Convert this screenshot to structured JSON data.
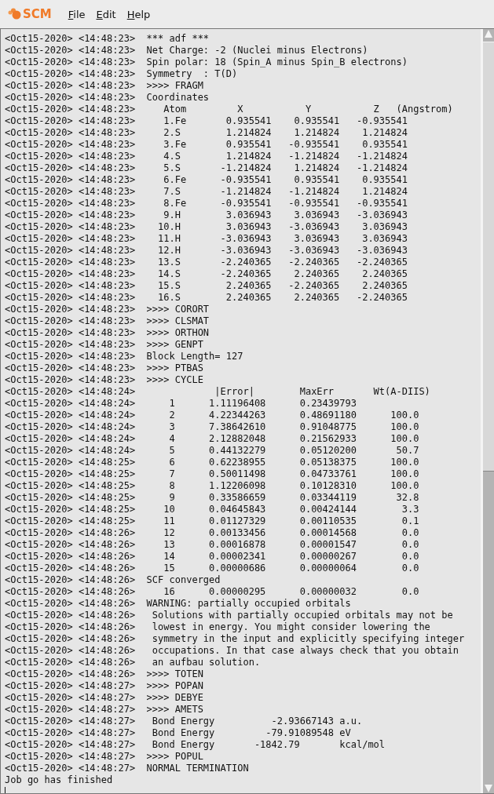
{
  "app": {
    "logo_text": "SCM"
  },
  "menu": [
    {
      "label": "File"
    },
    {
      "label": "Edit"
    },
    {
      "label": "Help"
    }
  ],
  "log": {
    "lines": [
      "<Oct15-2020> <14:48:23>  *** adf ***",
      "<Oct15-2020> <14:48:23>  Net Charge: -2 (Nuclei minus Electrons)",
      "<Oct15-2020> <14:48:23>  Spin polar: 18 (Spin_A minus Spin_B electrons)",
      "<Oct15-2020> <14:48:23>  Symmetry  : T(D)",
      "<Oct15-2020> <14:48:23>  >>>> FRAGM",
      "<Oct15-2020> <14:48:23>  Coordinates",
      "<Oct15-2020> <14:48:23>     Atom         X           Y           Z   (Angstrom)",
      "<Oct15-2020> <14:48:23>     1.Fe       0.935541    0.935541   -0.935541",
      "<Oct15-2020> <14:48:23>     2.S        1.214824    1.214824    1.214824",
      "<Oct15-2020> <14:48:23>     3.Fe       0.935541   -0.935541    0.935541",
      "<Oct15-2020> <14:48:23>     4.S        1.214824   -1.214824   -1.214824",
      "<Oct15-2020> <14:48:23>     5.S       -1.214824    1.214824   -1.214824",
      "<Oct15-2020> <14:48:23>     6.Fe      -0.935541    0.935541    0.935541",
      "<Oct15-2020> <14:48:23>     7.S       -1.214824   -1.214824    1.214824",
      "<Oct15-2020> <14:48:23>     8.Fe      -0.935541   -0.935541   -0.935541",
      "<Oct15-2020> <14:48:23>     9.H        3.036943    3.036943   -3.036943",
      "<Oct15-2020> <14:48:23>    10.H        3.036943   -3.036943    3.036943",
      "<Oct15-2020> <14:48:23>    11.H       -3.036943    3.036943    3.036943",
      "<Oct15-2020> <14:48:23>    12.H       -3.036943   -3.036943   -3.036943",
      "<Oct15-2020> <14:48:23>    13.S       -2.240365   -2.240365   -2.240365",
      "<Oct15-2020> <14:48:23>    14.S       -2.240365    2.240365    2.240365",
      "<Oct15-2020> <14:48:23>    15.S        2.240365   -2.240365    2.240365",
      "<Oct15-2020> <14:48:23>    16.S        2.240365    2.240365   -2.240365",
      "<Oct15-2020> <14:48:23>  >>>> CORORT",
      "<Oct15-2020> <14:48:23>  >>>> CLSMAT",
      "<Oct15-2020> <14:48:23>  >>>> ORTHON",
      "<Oct15-2020> <14:48:23>  >>>> GENPT",
      "<Oct15-2020> <14:48:23>  Block Length= 127",
      "<Oct15-2020> <14:48:23>  >>>> PTBAS",
      "<Oct15-2020> <14:48:23>  >>>> CYCLE",
      "<Oct15-2020> <14:48:24>              |Error|        MaxErr       Wt(A-DIIS)",
      "<Oct15-2020> <14:48:24>      1      1.11196408      0.23439793",
      "<Oct15-2020> <14:48:24>      2      4.22344263      0.48691180      100.0",
      "<Oct15-2020> <14:48:24>      3      7.38642610      0.91048775      100.0",
      "<Oct15-2020> <14:48:24>      4      2.12882048      0.21562933      100.0",
      "<Oct15-2020> <14:48:24>      5      0.44132279      0.05120200       50.7",
      "<Oct15-2020> <14:48:25>      6      0.62238955      0.05138375      100.0",
      "<Oct15-2020> <14:48:25>      7      0.50011498      0.04733761      100.0",
      "<Oct15-2020> <14:48:25>      8      1.12206098      0.10128310      100.0",
      "<Oct15-2020> <14:48:25>      9      0.33586659      0.03344119       32.8",
      "<Oct15-2020> <14:48:25>     10      0.04645843      0.00424144        3.3",
      "<Oct15-2020> <14:48:25>     11      0.01127329      0.00110535        0.1",
      "<Oct15-2020> <14:48:26>     12      0.00133456      0.00014568        0.0",
      "<Oct15-2020> <14:48:26>     13      0.00016878      0.00001547        0.0",
      "<Oct15-2020> <14:48:26>     14      0.00002341      0.00000267        0.0",
      "<Oct15-2020> <14:48:26>     15      0.00000686      0.00000064        0.0",
      "<Oct15-2020> <14:48:26>  SCF converged",
      "<Oct15-2020> <14:48:26>     16      0.00000295      0.00000032        0.0",
      "<Oct15-2020> <14:48:26>  WARNING: partially occupied orbitals",
      "<Oct15-2020> <14:48:26>   Solutions with partially occupied orbitals may not be",
      "<Oct15-2020> <14:48:26>   lowest in energy. You might consider lowering the",
      "<Oct15-2020> <14:48:26>   symmetry in the input and explicitly specifying integer",
      "<Oct15-2020> <14:48:26>   occupations. In that case always check that you obtain",
      "<Oct15-2020> <14:48:26>   an aufbau solution.",
      "<Oct15-2020> <14:48:26>  >>>> TOTEN",
      "<Oct15-2020> <14:48:27>  >>>> POPAN",
      "<Oct15-2020> <14:48:27>  >>>> DEBYE",
      "<Oct15-2020> <14:48:27>  >>>> AMETS",
      "<Oct15-2020> <14:48:27>   Bond Energy          -2.93667143 a.u.",
      "<Oct15-2020> <14:48:27>   Bond Energy         -79.91089548 eV",
      "<Oct15-2020> <14:48:27>   Bond Energy       -1842.79       kcal/mol",
      "<Oct15-2020> <14:48:27>  >>>> POPUL",
      "<Oct15-2020> <14:48:27>  NORMAL TERMINATION",
      "Job go has finished"
    ]
  }
}
